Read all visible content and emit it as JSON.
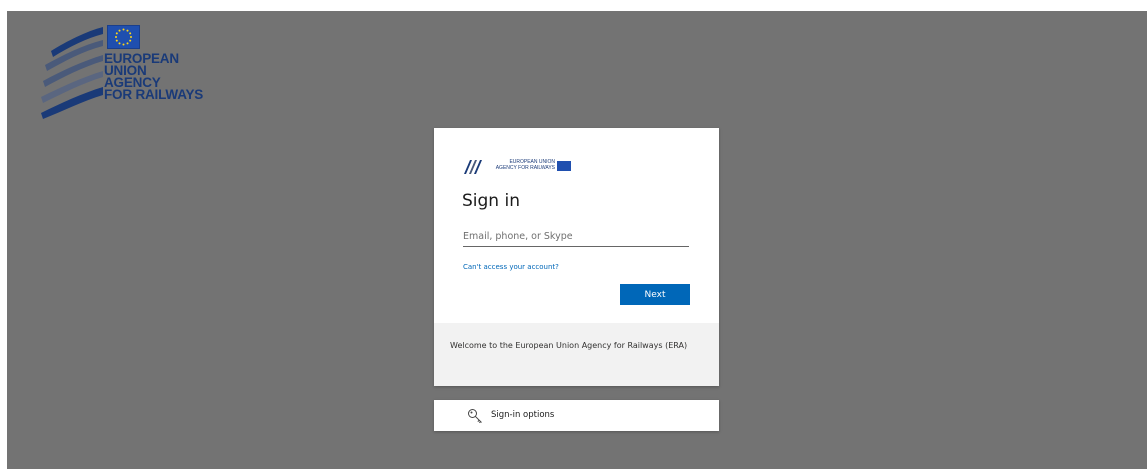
{
  "brand": {
    "lines": [
      "EUROPEAN",
      "UNION",
      "AGENCY",
      "FOR RAILWAYS"
    ],
    "flag_color": "#1f4faf",
    "text_color": "#1a3a78"
  },
  "card": {
    "mini_logo_text": [
      "EUROPEAN UNION",
      "AGENCY FOR RAILWAYS"
    ],
    "title": "Sign in",
    "email_placeholder": "Email, phone, or Skype",
    "email_value": "",
    "cant_access_link": "Can't access your account?",
    "next_button": "Next",
    "welcome_text": "Welcome to the European Union Agency for Railways (ERA)",
    "accent_color": "#0067b8"
  },
  "options": {
    "label": "Sign-in options",
    "icon": "key-icon"
  }
}
